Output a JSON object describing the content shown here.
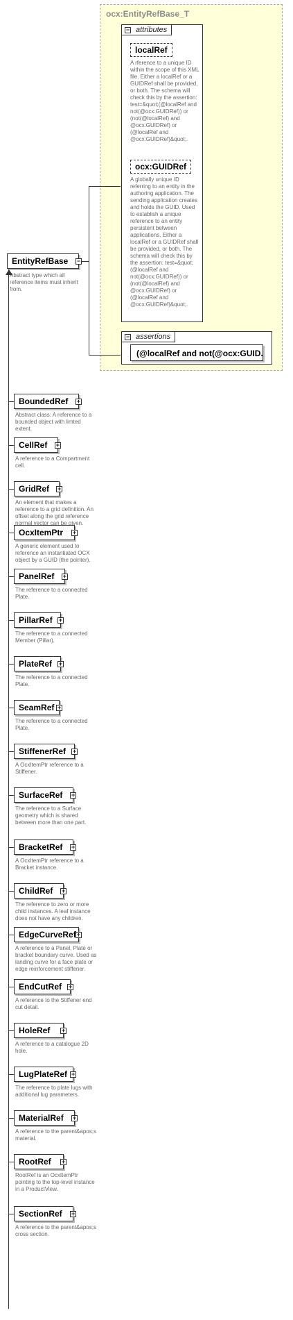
{
  "type_box": {
    "title": "ocx:EntityRefBase_T"
  },
  "attributes": {
    "label": "attributes",
    "items": [
      {
        "name": "localRef",
        "desc": "A rference to a unique ID within the scope of this XML file. Either a localRef or a GUIDRef shall be provided, or both. The schema will check this by the assertion: test=&quot;(@localRef and not(@ocx:GUIDRef)) or (not(@localRef) and @ocx:GUIDRef) or (@localRef and @ocx:GUIDRef)&quot;."
      },
      {
        "name": "ocx:GUIDRef",
        "desc": "A globally unique ID referring to an entity in the authoring application. The sending application creates and holds the GUID. Used to establish a unique reference to an entity persistent  between applications.  Either a localRef or a GUIDRef shall be provided, or both. The schema will check this by the assertion: test=&quot;(@localRef and not(@ocx:GUIDRef)) or (not(@localRef) and @ocx:GUIDRef) or (@localRef and @ocx:GUIDRef)&quot;."
      }
    ]
  },
  "assertions": {
    "label": "assertions",
    "item": "(@localRef and not(@ocx:GUID..."
  },
  "root": {
    "name": "EntityRefBase",
    "desc": "Abstract type which all reference items must inherit from."
  },
  "elements": [
    {
      "name": "BoundedRef",
      "desc": "Abstract class: A reference to a bounded object with limted extent."
    },
    {
      "name": "CellRef",
      "desc": "A reference to a Compartment cell."
    },
    {
      "name": "GridRef",
      "desc": "An element that makes a reference to a grid definition. An offset along the grid reference normal vector can be given."
    },
    {
      "name": "OcxItemPtr",
      "desc": "A generic element used to reference an instantiated OCX object by a GUID (the pointer)."
    },
    {
      "name": "PanelRef",
      "desc": "The reference to a connected Plate."
    },
    {
      "name": "PillarRef",
      "desc": "The reference to a connected Member (Pillar)."
    },
    {
      "name": "PlateRef",
      "desc": "The reference to a connected Plate."
    },
    {
      "name": "SeamRef",
      "desc": "The reference to a connected Plate."
    },
    {
      "name": "StiffenerRef",
      "desc": "A OcxItemPtr reference to a Stiffener."
    },
    {
      "name": "SurfaceRef",
      "desc": "The reference to a Surface geometry which is shared between more than one part."
    },
    {
      "name": "BracketRef",
      "desc": "A OcxItemPtr reference to a Bracket instance."
    },
    {
      "name": "ChildRef",
      "desc": "The reference to zero or more child instances. A leaf instance does not have any children."
    },
    {
      "name": "EdgeCurveRef",
      "desc": "A reference to a Panel, Plate or bracket boundary curve. Used as landing curve for a face plate or edge reinforcement stiffener."
    },
    {
      "name": "EndCutRef",
      "desc": "A reference to the Stiffener end cut detail."
    },
    {
      "name": "HoleRef",
      "desc": "A reference to a catalogue 2D hole."
    },
    {
      "name": "LugPlateRef",
      "desc": "The reference to plate lugs with additional lug parameters."
    },
    {
      "name": "MaterialRef",
      "desc": "A reference to the parent&apos;s material."
    },
    {
      "name": "RootRef",
      "desc": "RootRef is an OcxItemPtr pointing to the top-level instance in a ProductView."
    },
    {
      "name": "SectionRef",
      "desc": "A reference to the parent&apos;s cross section."
    }
  ]
}
